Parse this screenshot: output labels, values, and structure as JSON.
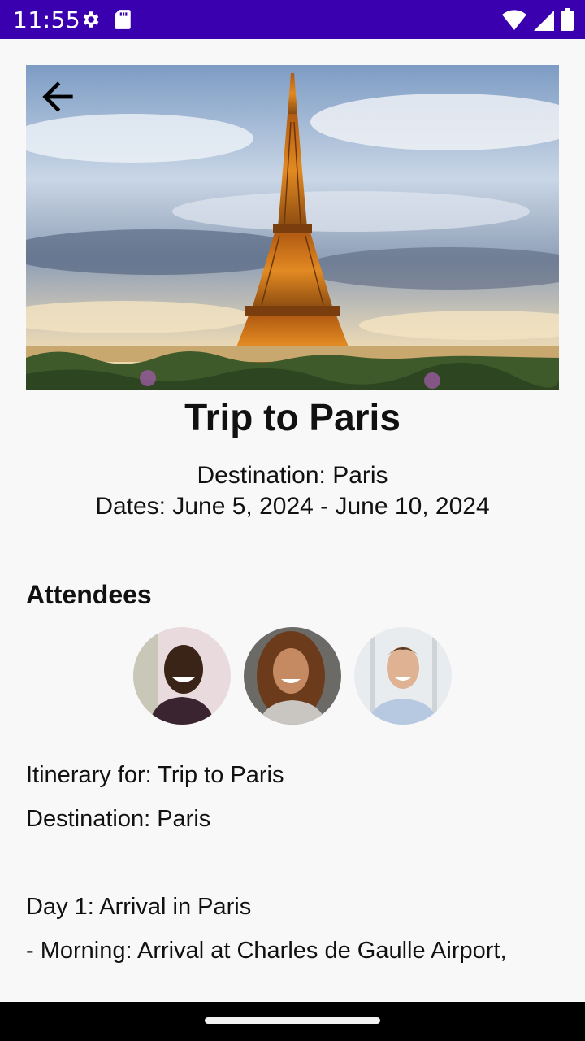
{
  "status_bar": {
    "time": "11:55",
    "icons": [
      "settings-icon",
      "sd-card-icon",
      "wifi-icon",
      "signal-icon",
      "battery-icon"
    ]
  },
  "header": {
    "back_icon": "arrow-back-icon",
    "hero_image": "eiffel-tower-photo"
  },
  "trip": {
    "title": "Trip to Paris",
    "destination": "Destination: Paris",
    "dates": "Dates: June 5, 2024 - June 10, 2024"
  },
  "attendees": {
    "heading": "Attendees",
    "people": [
      {
        "avatar": "attendee-photo-1"
      },
      {
        "avatar": "attendee-photo-2"
      },
      {
        "avatar": "attendee-photo-3"
      }
    ]
  },
  "itinerary": {
    "lines": [
      "Itinerary for: Trip to Paris",
      "Destination: Paris",
      "",
      "Day 1: Arrival in Paris",
      "- Morning: Arrival at Charles de Gaulle Airport,"
    ]
  },
  "colors": {
    "status_bar": "#3a00b0",
    "background": "#f8f8f9",
    "text": "#111111",
    "nav_bar": "#000000"
  }
}
